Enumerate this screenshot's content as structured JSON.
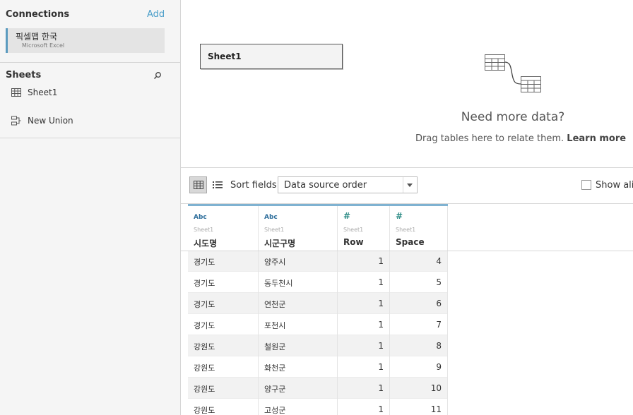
{
  "connections": {
    "title": "Connections",
    "add_label": "Add",
    "items": [
      {
        "name": "픽셀맵 한국",
        "type": "Microsoft Excel"
      }
    ]
  },
  "sheets": {
    "title": "Sheets",
    "items": [
      {
        "label": "Sheet1",
        "icon": "table-icon"
      },
      {
        "label": "New Union",
        "icon": "union-icon"
      }
    ]
  },
  "canvas": {
    "sheet_box": "Sheet1",
    "need_more_title": "Need more data?",
    "need_more_text": "Drag tables here to relate them.",
    "learn_more": "Learn more"
  },
  "toolbar": {
    "sort_label": "Sort fields",
    "sort_value": "Data source order",
    "show_aliases": "Show alia"
  },
  "table": {
    "columns": [
      {
        "type": "Abc",
        "source": "Sheet1",
        "name": "시도명"
      },
      {
        "type": "Abc",
        "source": "Sheet1",
        "name": "시군구명"
      },
      {
        "type": "#",
        "source": "Sheet1",
        "name": "Row"
      },
      {
        "type": "#",
        "source": "Sheet1",
        "name": "Space"
      }
    ],
    "rows": [
      [
        "경기도",
        "양주시",
        "1",
        "4"
      ],
      [
        "경기도",
        "동두천시",
        "1",
        "5"
      ],
      [
        "경기도",
        "연천군",
        "1",
        "6"
      ],
      [
        "경기도",
        "포천시",
        "1",
        "7"
      ],
      [
        "강원도",
        "철원군",
        "1",
        "8"
      ],
      [
        "강원도",
        "화천군",
        "1",
        "9"
      ],
      [
        "강원도",
        "양구군",
        "1",
        "10"
      ],
      [
        "강원도",
        "고성군",
        "1",
        "11"
      ]
    ]
  },
  "colors": {
    "accent": "#4b9ec9",
    "header_bar": "#7fb2d1",
    "row_alt": "#f2f2f2"
  }
}
